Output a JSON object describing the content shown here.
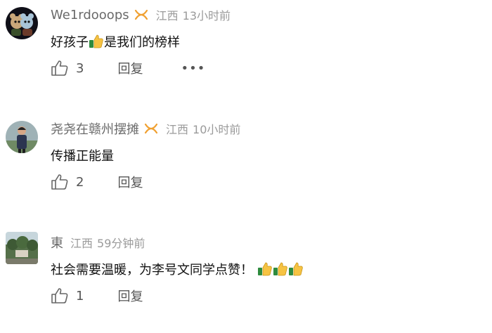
{
  "comments": [
    {
      "user": "We1rdooops",
      "location": "江西",
      "time": "13小时前",
      "text_before": "好孩子",
      "text_after": " 是我们的榜样",
      "likes": "3",
      "reply_label": "回复",
      "more_label": "•••",
      "badge": true,
      "avatar_icon": "cartoon-avatar"
    },
    {
      "user": "尧尧在赣州摆摊",
      "location": "江西",
      "time": "10小时前",
      "text": "传播正能量",
      "likes": "2",
      "reply_label": "回复",
      "badge": true,
      "avatar_icon": "person-avatar"
    },
    {
      "user": "東",
      "location": "江西",
      "time": "59分钟前",
      "text": "社会需要温暖，为李号文同学点赞！",
      "likes": "1",
      "reply_label": "回复",
      "badge": false,
      "avatar_icon": "landscape-avatar"
    }
  ],
  "colors": {
    "name": "#6a6a6a",
    "meta": "#9a9a9a",
    "badge": "#f0a030"
  }
}
